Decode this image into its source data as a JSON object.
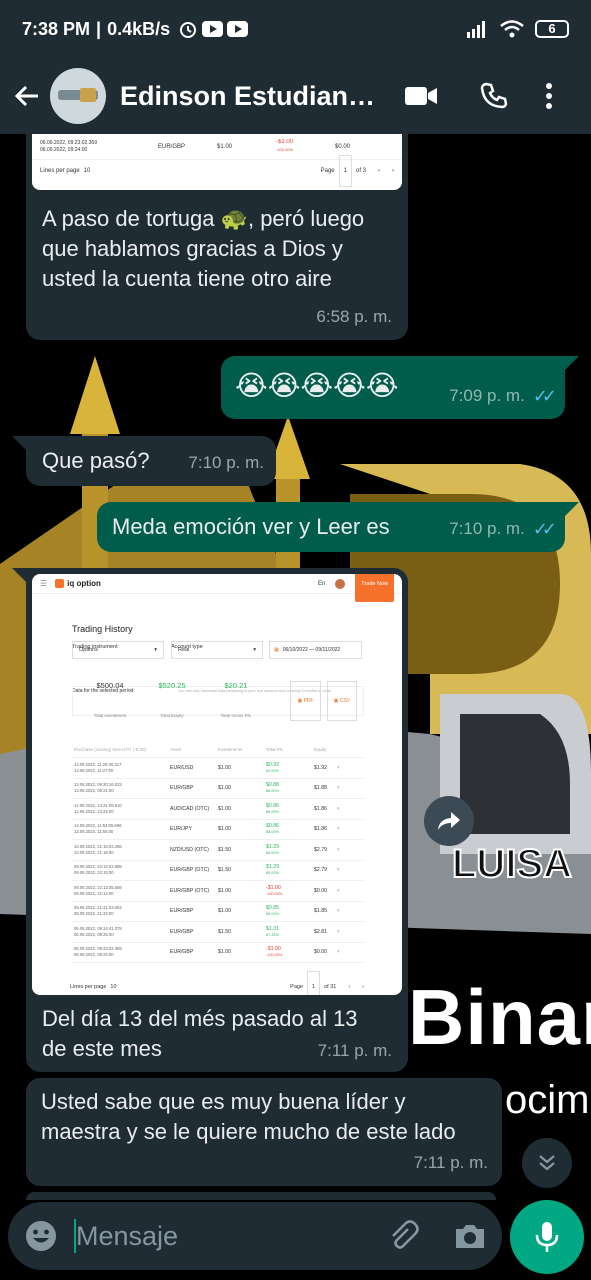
{
  "status_bar": {
    "time": "7:38 PM",
    "network_speed": "0.4kB/s",
    "battery": "6",
    "icons": [
      "alarm-icon",
      "youtube-icon",
      "youtube-icon",
      "signal-icon",
      "wifi-icon",
      "battery-icon"
    ]
  },
  "header": {
    "contact_name": "Edinson Estudiant…",
    "icons": [
      "back-arrow-icon",
      "video-call-icon",
      "voice-call-icon",
      "more-vertical-icon"
    ]
  },
  "messages": [
    {
      "direction": "incoming",
      "image": {
        "rows": [
          {
            "time_a": "06.09.2022, 09:23:02.369",
            "time_b": "06.09.2022, 09:24:00",
            "asset": "EUR/GBP",
            "investment": "$1.00",
            "pl": "-$1.00",
            "pl_pct": "-100.00%",
            "equity": "$0.00"
          }
        ],
        "footer": {
          "lines_per_page_label": "Lines per page",
          "lines_per_page": "10",
          "page_label": "Page",
          "page": "1",
          "of": "of 3"
        }
      },
      "text": "A paso de tortuga 🐢, peró luego que hablamos gracias a Dios y usted la cuenta tiene otro aire",
      "time": "6:58 p. m."
    },
    {
      "direction": "outgoing",
      "text": "😭😭😭😭😭",
      "time": "7:09 p. m.",
      "status": "read"
    },
    {
      "direction": "incoming",
      "text": "Que pasó?",
      "time": "7:10 p. m."
    },
    {
      "direction": "outgoing",
      "text": "Meda emoción ver y Leer es",
      "time": "7:10 p. m.",
      "status": "read"
    },
    {
      "direction": "incoming",
      "image": {
        "brand": "iq option",
        "lang": "En",
        "trade_now": "Trade Now",
        "page_title": "Trading History",
        "trading_instrument_label": "Trading instrument",
        "trading_instrument_value": "Options",
        "account_type_label": "Account type",
        "account_type_value": "Real",
        "date_range": "06/10/2022 — 09/11/2022",
        "data_label": "Data for the selected period",
        "data_note": "You can only download data pertaining to your real account and covering 6 months or more.",
        "stats": [
          {
            "value": "$500.04",
            "label": "Total investment",
            "color": "#333333"
          },
          {
            "value": "$520.25",
            "label": "Total Equity",
            "color": "#2bb45d"
          },
          {
            "value": "$20.21",
            "label": "Total Gross P/L",
            "color": "#2bb45d"
          }
        ],
        "pdf_label": "PDF",
        "csv_label": "CSV",
        "columns": [
          "Purchase (closing) time UTC (-5:00)",
          "Asset",
          "Investments",
          "Total P/L",
          "Equity"
        ],
        "rows": [
          {
            "time_a": "13.09.2022, 11:26:30.317",
            "time_b": "13.09.2022, 11:27:00",
            "asset": "EUR/USD",
            "investment": "$1.00",
            "pl": "$0.92",
            "pl_pct": "92.00%",
            "equity": "$1.92"
          },
          {
            "time_a": "13.09.2022, 06:20:16.023",
            "time_b": "13.09.2022, 06:21:00",
            "asset": "EUR/GBP",
            "investment": "$1.00",
            "pl": "$0.88",
            "pl_pct": "88.00%",
            "equity": "$1.88"
          },
          {
            "time_a": "12.09.2022, 13:21:09.510",
            "time_b": "12.09.2022, 13:22:00",
            "asset": "AUD/CAD (OTC)",
            "investment": "$1.00",
            "pl": "$0.86",
            "pl_pct": "86.00%",
            "equity": "$1.86"
          },
          {
            "time_a": "12.09.2022, 11:54:05.686",
            "time_b": "12.09.2022, 11:55:00",
            "asset": "EUR/JPY",
            "investment": "$1.00",
            "pl": "$0.86",
            "pl_pct": "86.00%",
            "equity": "$1.86"
          },
          {
            "time_a": "10.09.2022, 21:15:03.266",
            "time_b": "10.09.2022, 21:16:00",
            "asset": "NZD/USD (OTC)",
            "investment": "$1.50",
            "pl": "$1.29",
            "pl_pct": "86.00%",
            "equity": "$2.79"
          },
          {
            "time_a": "09.09.2022, 22:14:02.995",
            "time_b": "09.09.2022, 22:15:00",
            "asset": "EUR/GBP (OTC)",
            "investment": "$1.50",
            "pl": "$1.29",
            "pl_pct": "86.00%",
            "equity": "$2.79"
          },
          {
            "time_a": "09.09.2022, 22:13:05.566",
            "time_b": "09.09.2022, 22:14:00",
            "asset": "EUR/GBP (OTC)",
            "investment": "$1.00",
            "pl": "-$1.00",
            "pl_pct": "-100.00%",
            "equity": "$0.00"
          },
          {
            "time_a": "08.09.2022, 21:21:03.062",
            "time_b": "08.09.2022, 21:22:00",
            "asset": "EUR/GBP",
            "investment": "$1.00",
            "pl": "$0.85",
            "pl_pct": "85.00%",
            "equity": "$1.85"
          },
          {
            "time_a": "06.09.2022, 09:24:41.078",
            "time_b": "06.09.2022, 09:25:00",
            "asset": "EUR/GBP",
            "investment": "$1.50",
            "pl": "$1.31",
            "pl_pct": "87.33%",
            "equity": "$2.81"
          },
          {
            "time_a": "06.09.2022, 09:23:02.369",
            "time_b": "06.09.2022, 09:24:00",
            "asset": "EUR/GBP",
            "investment": "$1.00",
            "pl": "-$1.00",
            "pl_pct": "-100.00%",
            "equity": "$0.00"
          }
        ],
        "footer": {
          "lines_per_page_label": "Lines per page",
          "lines_per_page": "10",
          "page_label": "Page",
          "page": "1",
          "of": "of 31"
        }
      },
      "text": "Del día 13 del més pasado al 13 de este mes",
      "time": "7:11 p. m."
    },
    {
      "direction": "incoming",
      "text": "Usted sabe que es muy buena líder y maestra y se le quiere mucho de este lado",
      "time": "7:11 p. m."
    }
  ],
  "wallpaper": {
    "text_fragments": [
      "Binar",
      "ocimi",
      "LUISA"
    ]
  },
  "input": {
    "placeholder": "Mensaje",
    "icons": [
      "emoji-icon",
      "attach-icon",
      "camera-icon",
      "mic-icon"
    ]
  },
  "colors": {
    "header_bg": "#1f2c34",
    "incoming_bubble": "#1f2c34",
    "outgoing_bubble": "#005c4b",
    "accent": "#00a884",
    "read_ticks": "#53bdeb",
    "iq_orange": "#f5712c"
  }
}
